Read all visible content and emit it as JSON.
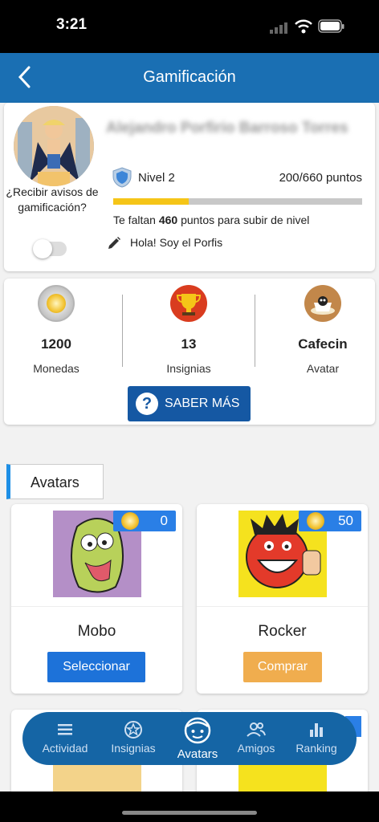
{
  "status": {
    "time": "3:21"
  },
  "header": {
    "title": "Gamificación",
    "back_icon": "chevron-left-icon"
  },
  "profile": {
    "name": "Alejandro Porfirio Barroso Torres",
    "notify_label": "¿Recibir avisos de gamificación?",
    "notify_enabled": false,
    "level": "Nivel 2",
    "points": "200/660 puntos",
    "progress": 0.303,
    "need_prefix": "Te faltan ",
    "need_value": "460",
    "need_suffix": " puntos para subir de nivel",
    "motto": "Hola! Soy el Porfis"
  },
  "stats": {
    "coins_value": "1200",
    "coins_label": "Monedas",
    "badges_value": "13",
    "badges_label": "Insignias",
    "avatar_value": "Cafecin",
    "avatar_label": "Avatar",
    "more_button": "SABER MÁS"
  },
  "avatars_section": "Avatars",
  "avatars": [
    {
      "name": "Mobo",
      "price": "0",
      "button": "Seleccionar",
      "button_color": "#1d72d9"
    },
    {
      "name": "Rocker",
      "price": "50",
      "button": "Comprar",
      "button_color": "#f0ad4e"
    }
  ],
  "bottom_nav": [
    {
      "label": "Actividad",
      "icon": "list-icon"
    },
    {
      "label": "Insignias",
      "icon": "star-badge-icon"
    },
    {
      "label": "Avatars",
      "icon": "face-icon"
    },
    {
      "label": "Amigos",
      "icon": "people-icon"
    },
    {
      "label": "Ranking",
      "icon": "bar-chart-icon"
    }
  ],
  "colors": {
    "header": "#1a6fb3",
    "accent": "#1558a3",
    "progress": "#f5c518"
  }
}
